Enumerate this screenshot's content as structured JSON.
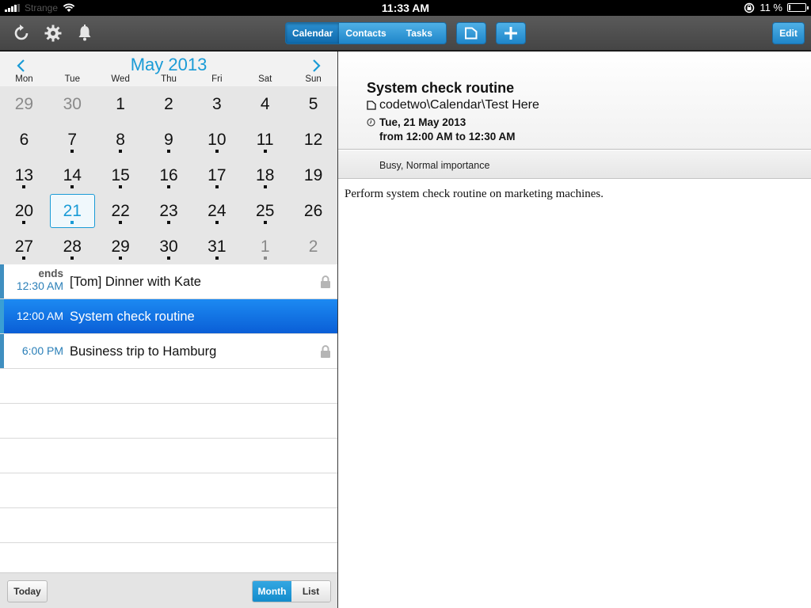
{
  "status_bar": {
    "carrier": "Strange",
    "time": "11:33 AM",
    "battery": "11 %",
    "battery_level": 0.11
  },
  "toolbar": {
    "icons": [
      "refresh-icon",
      "gear-icon",
      "bell-icon"
    ],
    "tabs": [
      {
        "label": "Calendar",
        "active": true
      },
      {
        "label": "Contacts",
        "active": false
      },
      {
        "label": "Tasks",
        "active": false
      }
    ],
    "edit_label": "Edit"
  },
  "calendar": {
    "month_title": "May 2013",
    "weekdays": [
      "Mon",
      "Tue",
      "Wed",
      "Thu",
      "Fri",
      "Sat",
      "Sun"
    ],
    "weeks": [
      [
        {
          "d": "29",
          "other": true,
          "dot": false
        },
        {
          "d": "30",
          "other": true,
          "dot": false
        },
        {
          "d": "1",
          "dot": false
        },
        {
          "d": "2",
          "dot": false
        },
        {
          "d": "3",
          "dot": false
        },
        {
          "d": "4",
          "dot": false
        },
        {
          "d": "5",
          "dot": false
        }
      ],
      [
        {
          "d": "6",
          "dot": false
        },
        {
          "d": "7",
          "dot": true
        },
        {
          "d": "8",
          "dot": true
        },
        {
          "d": "9",
          "dot": true
        },
        {
          "d": "10",
          "dot": true
        },
        {
          "d": "11",
          "dot": true
        },
        {
          "d": "12",
          "dot": false
        }
      ],
      [
        {
          "d": "13",
          "dot": true
        },
        {
          "d": "14",
          "dot": true
        },
        {
          "d": "15",
          "dot": true
        },
        {
          "d": "16",
          "dot": true
        },
        {
          "d": "17",
          "dot": true
        },
        {
          "d": "18",
          "dot": true
        },
        {
          "d": "19",
          "dot": false
        }
      ],
      [
        {
          "d": "20",
          "dot": true
        },
        {
          "d": "21",
          "dot": true,
          "selected": true
        },
        {
          "d": "22",
          "dot": true
        },
        {
          "d": "23",
          "dot": true
        },
        {
          "d": "24",
          "dot": true
        },
        {
          "d": "25",
          "dot": true
        },
        {
          "d": "26",
          "dot": false
        }
      ],
      [
        {
          "d": "27",
          "dot": true
        },
        {
          "d": "28",
          "dot": true
        },
        {
          "d": "29",
          "dot": true
        },
        {
          "d": "30",
          "dot": true
        },
        {
          "d": "31",
          "dot": true
        },
        {
          "d": "1",
          "other": true,
          "dot": true
        },
        {
          "d": "2",
          "other": true,
          "dot": false
        }
      ]
    ]
  },
  "events": [
    {
      "ends": "ends",
      "time": "12:30 AM",
      "title": "[Tom] Dinner with Kate",
      "locked": true,
      "selected": false
    },
    {
      "ends": "",
      "time": "12:00 AM",
      "title": "System check routine",
      "locked": false,
      "selected": true
    },
    {
      "ends": "",
      "time": "6:00 PM",
      "title": "Business trip to Hamburg",
      "locked": true,
      "selected": false
    }
  ],
  "footer": {
    "today_label": "Today",
    "month_label": "Month",
    "list_label": "List"
  },
  "detail": {
    "title": "System check routine",
    "folder": "codetwo\\Calendar\\Test Here",
    "date": "Tue, 21 May 2013",
    "range": "from 12:00 AM to 12:30 AM",
    "meta": "Busy, Normal importance",
    "body": "Perform system check routine on marketing machines."
  }
}
